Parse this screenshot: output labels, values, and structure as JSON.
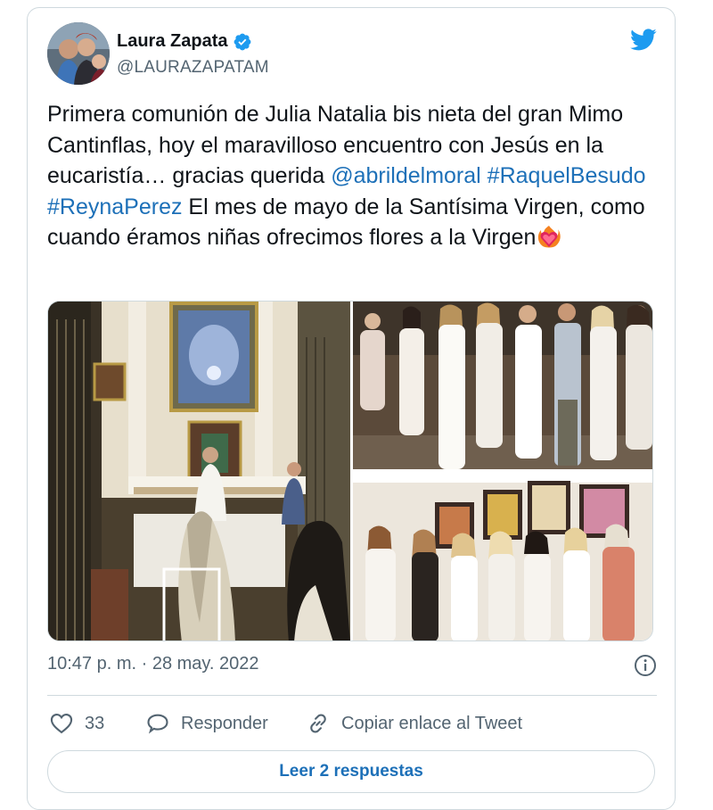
{
  "tweet": {
    "author": {
      "name": "Laura Zapata",
      "handle": "@LAURAZAPATAM",
      "verified": true
    },
    "text_segments": [
      {
        "text": "Primera comunión de Julia Natalia bis nieta del gran Mimo Cantinflas, hoy el maravilloso encuentro con Jesús en la eucaristía… gracias querida ",
        "type": "text"
      },
      {
        "text": "@abrildelmoral",
        "type": "mention"
      },
      {
        "text": " ",
        "type": "text"
      },
      {
        "text": "#RaquelBesudo",
        "type": "hashtag"
      },
      {
        "text": " ",
        "type": "text"
      },
      {
        "text": "#ReynaPerez",
        "type": "hashtag"
      },
      {
        "text": " El mes de mayo de la Santísima Virgen, como cuando éramos niñas ofrecimos flores a la Virgen",
        "type": "text"
      }
    ],
    "emoji": "heart-on-fire-icon",
    "photos": [
      "church-altar-photo",
      "group-photo-outdoor",
      "group-photo-gallery"
    ],
    "timestamp": "10:47 p. m. · 28 may. 2022",
    "likes": "33",
    "reply_label": "Responder",
    "copy_link_label": "Copiar enlace al Tweet",
    "read_replies_label": "Leer 2 respuestas"
  },
  "colors": {
    "link": "#1d70b8",
    "twitter_blue": "#1d9bf0",
    "secondary_text": "#536471",
    "border": "#cfd9de"
  }
}
